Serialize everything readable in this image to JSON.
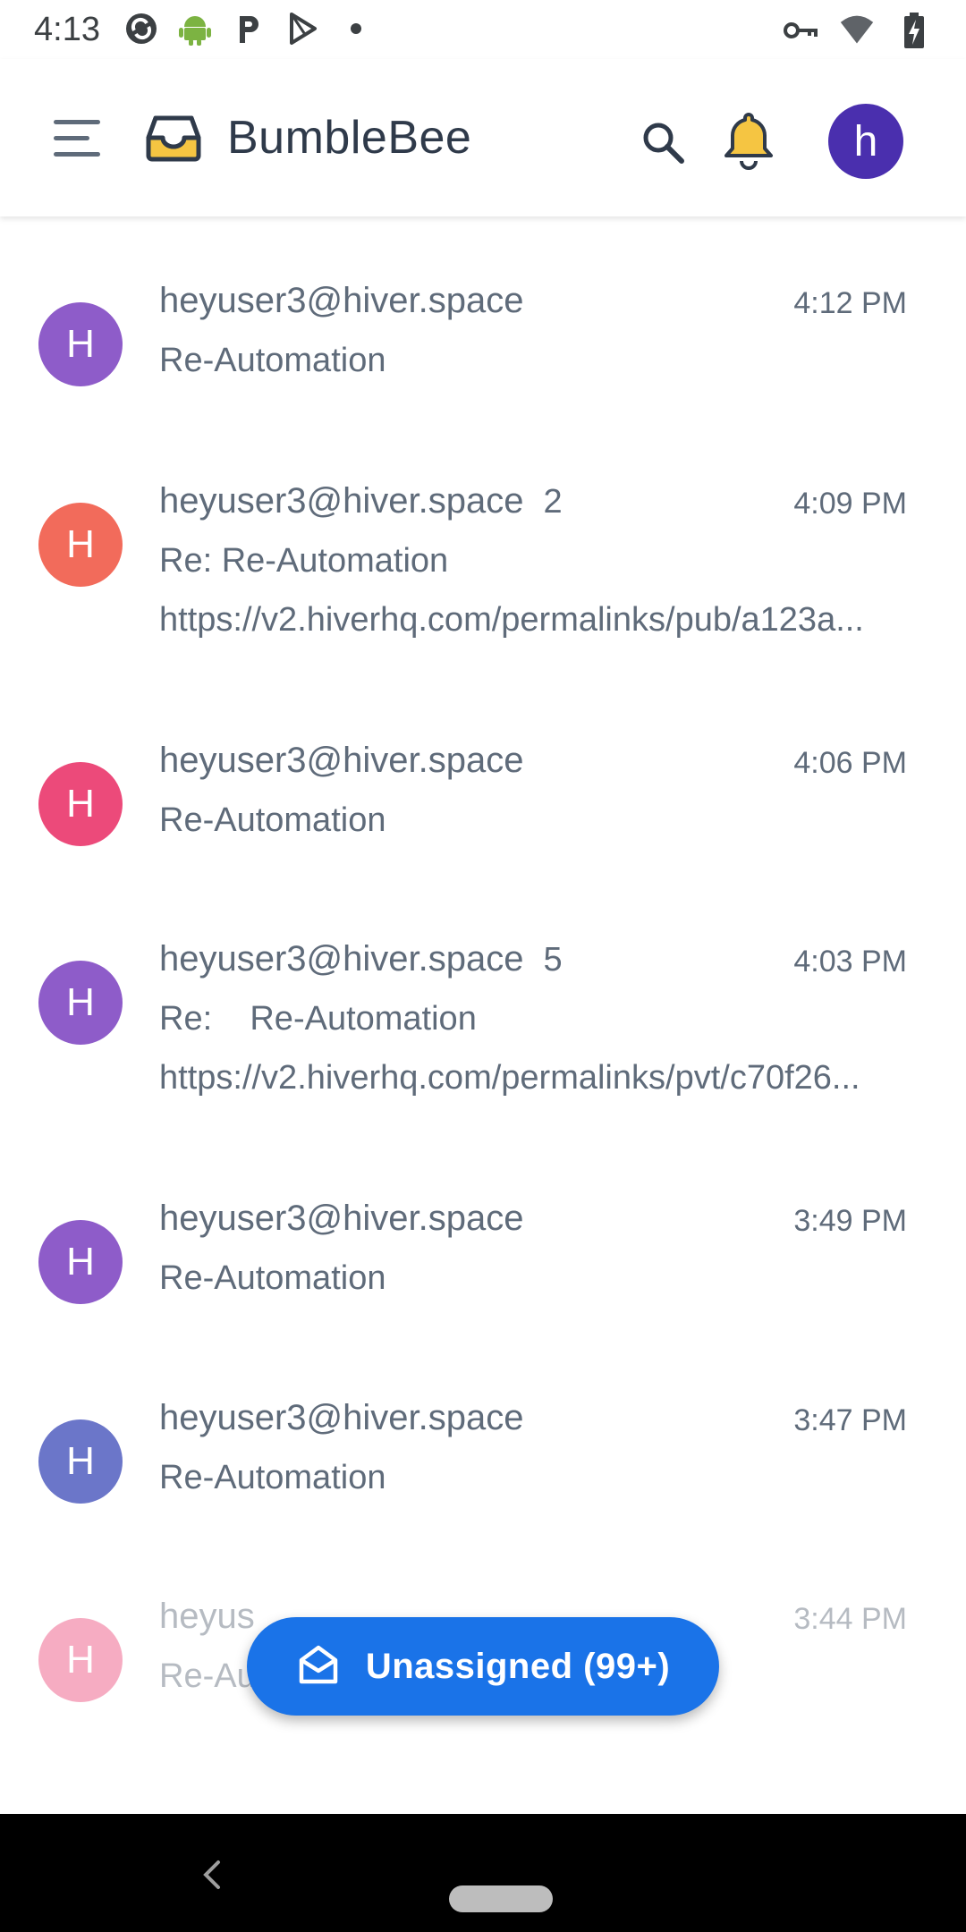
{
  "status_bar": {
    "time": "4:13",
    "left_icons": [
      "sync-icon",
      "android-icon",
      "parking-icon",
      "play-store-icon",
      "dot-icon"
    ],
    "right_icons": [
      "vpn-key-icon",
      "wifi-icon",
      "battery-charging-icon"
    ]
  },
  "app_bar": {
    "title": "BumbleBee",
    "avatar_letter": "h",
    "avatar_color": "#4a2fae"
  },
  "conversations": [
    {
      "avatar_letter": "H",
      "avatar_color": "#8e5cc9",
      "from": "heyuser3@hiver.space",
      "count": "",
      "time": "4:12 PM",
      "subject": "Re-Automation",
      "snippet": ""
    },
    {
      "avatar_letter": "H",
      "avatar_color": "#f26b5b",
      "from": "heyuser3@hiver.space",
      "count": "2",
      "time": "4:09 PM",
      "subject": "Re: Re-Automation",
      "snippet": "https://v2.hiverhq.com/permalinks/pub/a123a..."
    },
    {
      "avatar_letter": "H",
      "avatar_color": "#ec4a7a",
      "from": "heyuser3@hiver.space",
      "count": "",
      "time": "4:06 PM",
      "subject": "Re-Automation",
      "snippet": ""
    },
    {
      "avatar_letter": "H",
      "avatar_color": "#8e5cc9",
      "from": "heyuser3@hiver.space",
      "count": "5",
      "time": "4:03 PM",
      "subject": "Re:    Re-Automation",
      "snippet": "https://v2.hiverhq.com/permalinks/pvt/c70f26..."
    },
    {
      "avatar_letter": "H",
      "avatar_color": "#8e5cc9",
      "from": "heyuser3@hiver.space",
      "count": "",
      "time": "3:49 PM",
      "subject": "Re-Automation",
      "snippet": ""
    },
    {
      "avatar_letter": "H",
      "avatar_color": "#6b76c9",
      "from": "heyuser3@hiver.space",
      "count": "",
      "time": "3:47 PM",
      "subject": "Re-Automation",
      "snippet": ""
    },
    {
      "avatar_letter": "H",
      "avatar_color": "#ec4a7a",
      "from": "heyus",
      "count": "",
      "time": "3:44 PM",
      "subject": "Re-Au",
      "snippet": ""
    }
  ],
  "fab": {
    "label": "Unassigned (99+)",
    "icon": "open-mail-icon",
    "color": "#1a73e8"
  },
  "nav_bar": {
    "icons": [
      "back-icon",
      "home-pill-icon"
    ]
  }
}
